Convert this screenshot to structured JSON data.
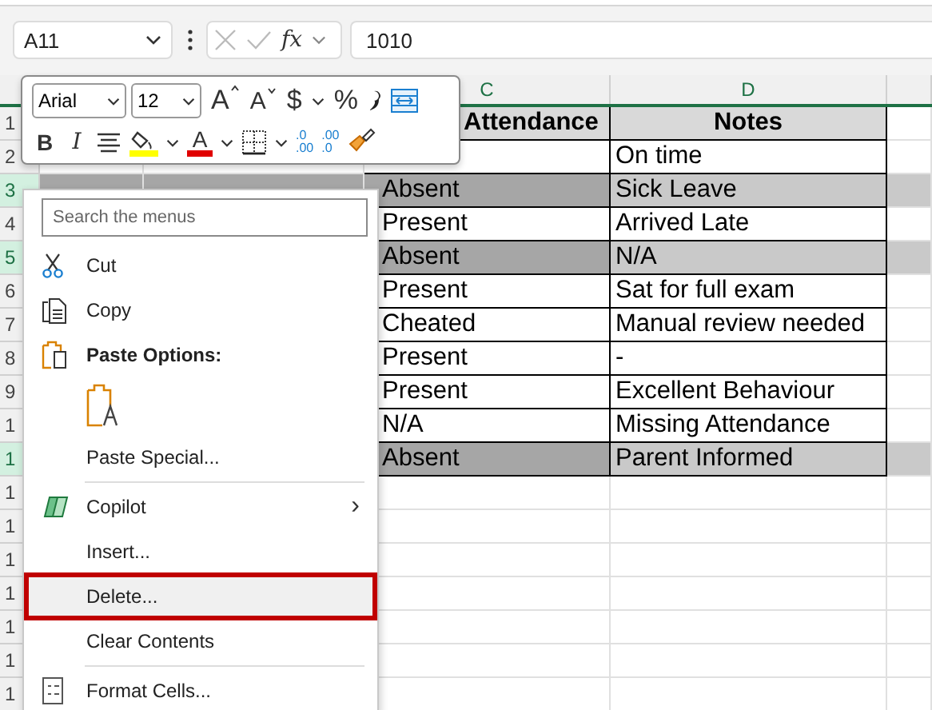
{
  "formula_bar": {
    "name_box": "A11",
    "function_label": "fx",
    "formula": "1010"
  },
  "columns": [
    {
      "label": "C"
    },
    {
      "label": "D"
    }
  ],
  "rows": [
    {
      "number": "1",
      "kind": "header",
      "selected": false,
      "attendance": "Attendance",
      "notes": "Notes"
    },
    {
      "number": "2",
      "kind": "data",
      "selected": false,
      "notes": "On time"
    },
    {
      "number": "3",
      "kind": "data",
      "selected": true,
      "attendance": "Absent",
      "notes": "Sick Leave"
    },
    {
      "number": "4",
      "kind": "data",
      "selected": false,
      "attendance": "Present",
      "notes": "Arrived Late"
    },
    {
      "number": "5",
      "kind": "data",
      "selected": true,
      "attendance": "Absent",
      "notes": "N/A"
    },
    {
      "number": "6",
      "kind": "data",
      "selected": false,
      "attendance": "Present",
      "notes": "Sat for full exam"
    },
    {
      "number": "7",
      "kind": "data",
      "selected": false,
      "attendance": "Cheated",
      "notes": "Manual review needed"
    },
    {
      "number": "8",
      "kind": "data",
      "selected": false,
      "attendance": "Present",
      "notes": "-"
    },
    {
      "number": "9",
      "kind": "data",
      "selected": false,
      "attendance": "Present",
      "notes": "Excellent Behaviour"
    },
    {
      "number": "1",
      "kind": "data",
      "selected": false,
      "attendance": "N/A",
      "notes": "Missing Attendance"
    },
    {
      "number": "1",
      "kind": "data",
      "selected": true,
      "attendance": "Absent",
      "notes": "Parent Informed"
    },
    {
      "number": "1",
      "kind": "empty",
      "selected": false
    },
    {
      "number": "1",
      "kind": "empty",
      "selected": false
    },
    {
      "number": "1",
      "kind": "empty",
      "selected": false
    },
    {
      "number": "1",
      "kind": "empty",
      "selected": false
    },
    {
      "number": "1",
      "kind": "empty",
      "selected": false
    },
    {
      "number": "1",
      "kind": "empty",
      "selected": false
    },
    {
      "number": "1",
      "kind": "empty",
      "selected": false
    }
  ],
  "mini_toolbar": {
    "font": "Arial",
    "size": "12",
    "row1": [
      {
        "kind": "grow",
        "label": "A"
      },
      {
        "kind": "shrink",
        "label": "A"
      },
      {
        "kind": "currency",
        "label": "$"
      },
      {
        "kind": "percent",
        "label": "%"
      },
      {
        "kind": "comma"
      },
      {
        "kind": "wrap"
      }
    ],
    "row2": [
      {
        "kind": "bold",
        "label": "B"
      },
      {
        "kind": "italic",
        "label": "I"
      },
      {
        "kind": "align"
      },
      {
        "kind": "fill"
      },
      {
        "kind": "fontcolor",
        "label": "A"
      },
      {
        "kind": "borders"
      },
      {
        "kind": "incdec",
        "top": ".0",
        "bottom": ".00"
      },
      {
        "kind": "decdec",
        "top": ".00",
        "bottom": ".0"
      },
      {
        "kind": "painter"
      }
    ]
  },
  "context_menu": {
    "search_placeholder": "Search the menus",
    "items": [
      {
        "kind": "cut",
        "label": "Cut",
        "highlighted": false
      },
      {
        "kind": "copy",
        "label": "Copy",
        "highlighted": false
      },
      {
        "kind": "heading",
        "label": "Paste Options:",
        "highlighted": false
      },
      {
        "kind": "paste"
      },
      {
        "kind": "plain",
        "label": "Paste Special...",
        "highlighted": false
      },
      {
        "kind": "separator"
      },
      {
        "kind": "submenu",
        "label": "Copilot",
        "arrow": "›",
        "highlighted": false
      },
      {
        "kind": "plain",
        "label": "Insert...",
        "highlighted": false
      },
      {
        "kind": "plain",
        "label": "Delete...",
        "highlighted": true
      },
      {
        "kind": "plain",
        "label": "Clear Contents",
        "highlighted": false
      },
      {
        "kind": "separator"
      },
      {
        "kind": "format",
        "label": "Format Cells...",
        "highlighted": false
      }
    ]
  }
}
